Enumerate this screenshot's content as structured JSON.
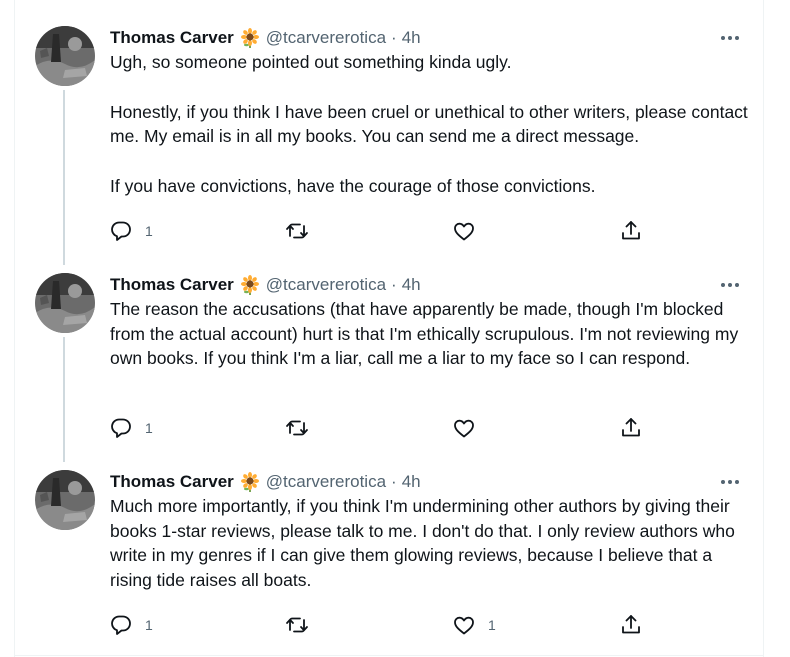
{
  "colors": {
    "text": "#0f1419",
    "secondary": "#536471",
    "thread_line": "#cfd9de",
    "divider": "#eff3f4"
  },
  "tweets": [
    {
      "author": {
        "name": "Thomas Carver",
        "badge_icon": "sunflower-emoji",
        "handle": "@tcarvererotica"
      },
      "separator": "·",
      "time": "4h",
      "paragraphs": [
        "Ugh, so someone pointed out something kinda ugly.",
        "Honestly, if you think I have been cruel or unethical to other writers, please contact me. My email is in all my books. You can send me a direct message.",
        "If you have convictions, have the courage of those convictions."
      ],
      "actions": {
        "reply_count": "1",
        "retweet_count": "",
        "like_count": ""
      }
    },
    {
      "author": {
        "name": "Thomas Carver",
        "badge_icon": "sunflower-emoji",
        "handle": "@tcarvererotica"
      },
      "separator": "·",
      "time": "4h",
      "paragraphs": [
        "The reason the accusations (that have apparently be made, though I'm blocked from the actual account) hurt is that I'm ethically scrupulous. I'm not reviewing my own books. If you think I'm a liar, call me a liar to my face so I can respond."
      ],
      "actions": {
        "reply_count": "1",
        "retweet_count": "",
        "like_count": ""
      }
    },
    {
      "author": {
        "name": "Thomas Carver",
        "badge_icon": "sunflower-emoji",
        "handle": "@tcarvererotica"
      },
      "separator": "·",
      "time": "4h",
      "paragraphs": [
        "Much more importantly, if you think I'm undermining other authors by giving their books 1-star reviews, please talk to me. I don't do that. I only review authors who write in my genres if I can give them glowing reviews, because I believe that a rising tide raises all boats."
      ],
      "actions": {
        "reply_count": "1",
        "retweet_count": "",
        "like_count": "1"
      }
    }
  ]
}
